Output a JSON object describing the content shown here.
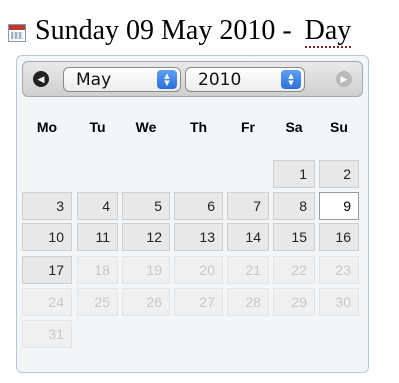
{
  "header": {
    "title": "Sunday 09 May 2010 -",
    "view_label": "Day"
  },
  "picker": {
    "prev_icon": "◀",
    "next_icon": "▶",
    "month": "May",
    "year": "2010",
    "weekdays": [
      "Mo",
      "Tu",
      "We",
      "Th",
      "Fr",
      "Sa",
      "Su"
    ],
    "days": [
      {
        "label": "1",
        "week": 0,
        "col": 5,
        "state": "current"
      },
      {
        "label": "2",
        "week": 0,
        "col": 6,
        "state": "current"
      },
      {
        "label": "3",
        "week": 1,
        "col": 0,
        "state": "current"
      },
      {
        "label": "4",
        "week": 1,
        "col": 1,
        "state": "current"
      },
      {
        "label": "5",
        "week": 1,
        "col": 2,
        "state": "current"
      },
      {
        "label": "6",
        "week": 1,
        "col": 3,
        "state": "current"
      },
      {
        "label": "7",
        "week": 1,
        "col": 4,
        "state": "current"
      },
      {
        "label": "8",
        "week": 1,
        "col": 5,
        "state": "current"
      },
      {
        "label": "9",
        "week": 1,
        "col": 6,
        "state": "today"
      },
      {
        "label": "10",
        "week": 2,
        "col": 0,
        "state": "current"
      },
      {
        "label": "11",
        "week": 2,
        "col": 1,
        "state": "current"
      },
      {
        "label": "12",
        "week": 2,
        "col": 2,
        "state": "current"
      },
      {
        "label": "13",
        "week": 2,
        "col": 3,
        "state": "current"
      },
      {
        "label": "14",
        "week": 2,
        "col": 4,
        "state": "current"
      },
      {
        "label": "15",
        "week": 2,
        "col": 5,
        "state": "current"
      },
      {
        "label": "16",
        "week": 2,
        "col": 6,
        "state": "current"
      },
      {
        "label": "17",
        "week": 3,
        "col": 0,
        "state": "current"
      },
      {
        "label": "18",
        "week": 3,
        "col": 1,
        "state": "other"
      },
      {
        "label": "19",
        "week": 3,
        "col": 2,
        "state": "other"
      },
      {
        "label": "20",
        "week": 3,
        "col": 3,
        "state": "other"
      },
      {
        "label": "21",
        "week": 3,
        "col": 4,
        "state": "other"
      },
      {
        "label": "22",
        "week": 3,
        "col": 5,
        "state": "other"
      },
      {
        "label": "23",
        "week": 3,
        "col": 6,
        "state": "other"
      },
      {
        "label": "24",
        "week": 4,
        "col": 0,
        "state": "other"
      },
      {
        "label": "25",
        "week": 4,
        "col": 1,
        "state": "other"
      },
      {
        "label": "26",
        "week": 4,
        "col": 2,
        "state": "other"
      },
      {
        "label": "27",
        "week": 4,
        "col": 3,
        "state": "other"
      },
      {
        "label": "28",
        "week": 4,
        "col": 4,
        "state": "other"
      },
      {
        "label": "29",
        "week": 4,
        "col": 5,
        "state": "other"
      },
      {
        "label": "30",
        "week": 4,
        "col": 6,
        "state": "other"
      },
      {
        "label": "31",
        "week": 5,
        "col": 0,
        "state": "other"
      }
    ]
  }
}
